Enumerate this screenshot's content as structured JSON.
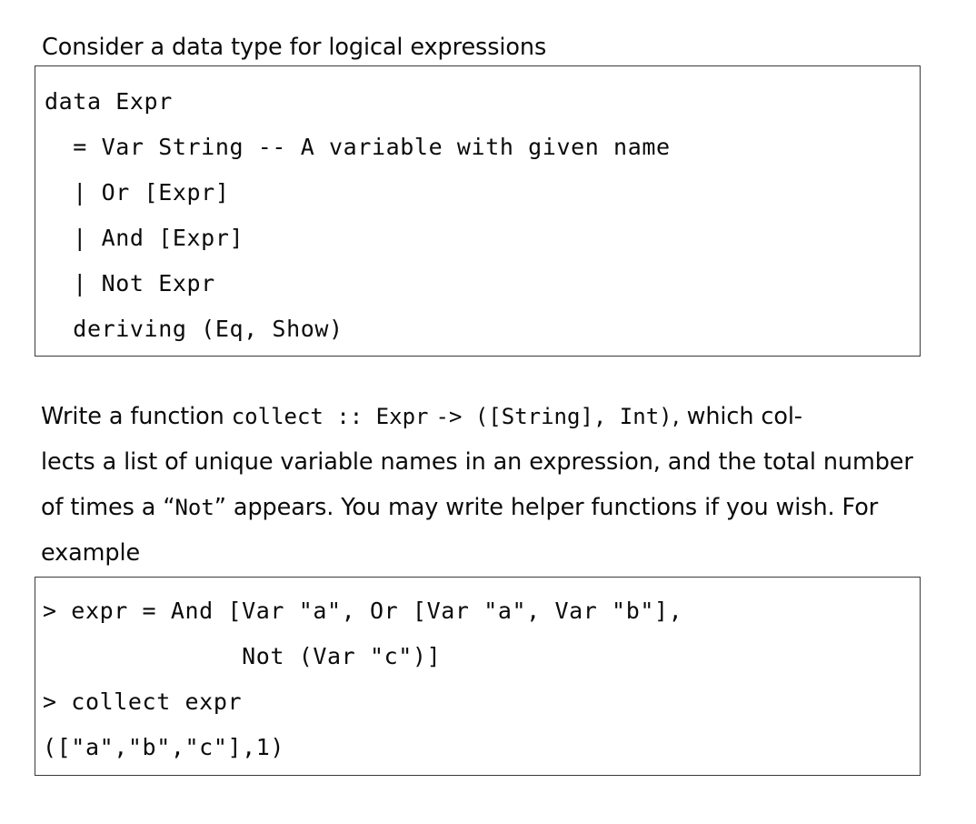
{
  "document": {
    "lead_text": "Consider a data type for logical expressions",
    "code_block_1": {
      "lines": [
        "data Expr",
        "  = Var String -- A variable with given name",
        "  | Or [Expr]",
        "  | And [Expr]",
        "  | Not Expr",
        "  deriving (Eq, Show)"
      ]
    },
    "paragraph": {
      "lines": [
        {
          "segments": [
            {
              "kind": "text",
              "value": "Write a function "
            },
            {
              "kind": "code",
              "value": "collect :: Expr"
            },
            {
              "kind": "text",
              "value": " "
            }
          ]
        },
        {
          "segments": [
            {
              "kind": "code",
              "value": "-> ([String], Int)"
            },
            {
              "kind": "text",
              "value": ", which col-"
            }
          ]
        },
        {
          "segments": [
            {
              "kind": "text",
              "value": "lects a list of unique variable names in an expression, and the total number"
            }
          ]
        },
        {
          "segments": [
            {
              "kind": "text",
              "value": "of times a “"
            },
            {
              "kind": "code",
              "value": "Not"
            },
            {
              "kind": "text",
              "value": "” appears.  You may write helper functions if you wish.  For"
            }
          ]
        },
        {
          "segments": [
            {
              "kind": "text",
              "value": "example"
            }
          ]
        }
      ],
      "full_text": "Write a function collect :: Expr -> ([String], Int), which collects a list of unique variable names in an expression, and the total number of times a “Not” appears. You may write helper functions if you wish. For example"
    },
    "code_block_2": {
      "lines": [
        "> expr = And [Var \"a\", Or [Var \"a\", Var \"b\"],",
        "              Not (Var \"c\")]",
        "> collect expr",
        "([\"a\",\"b\",\"c\"],1)"
      ]
    }
  },
  "style": {
    "page_background": "#ffffff",
    "text_color": "#0b0b0b",
    "box_border_color": "#3a3a3a"
  }
}
